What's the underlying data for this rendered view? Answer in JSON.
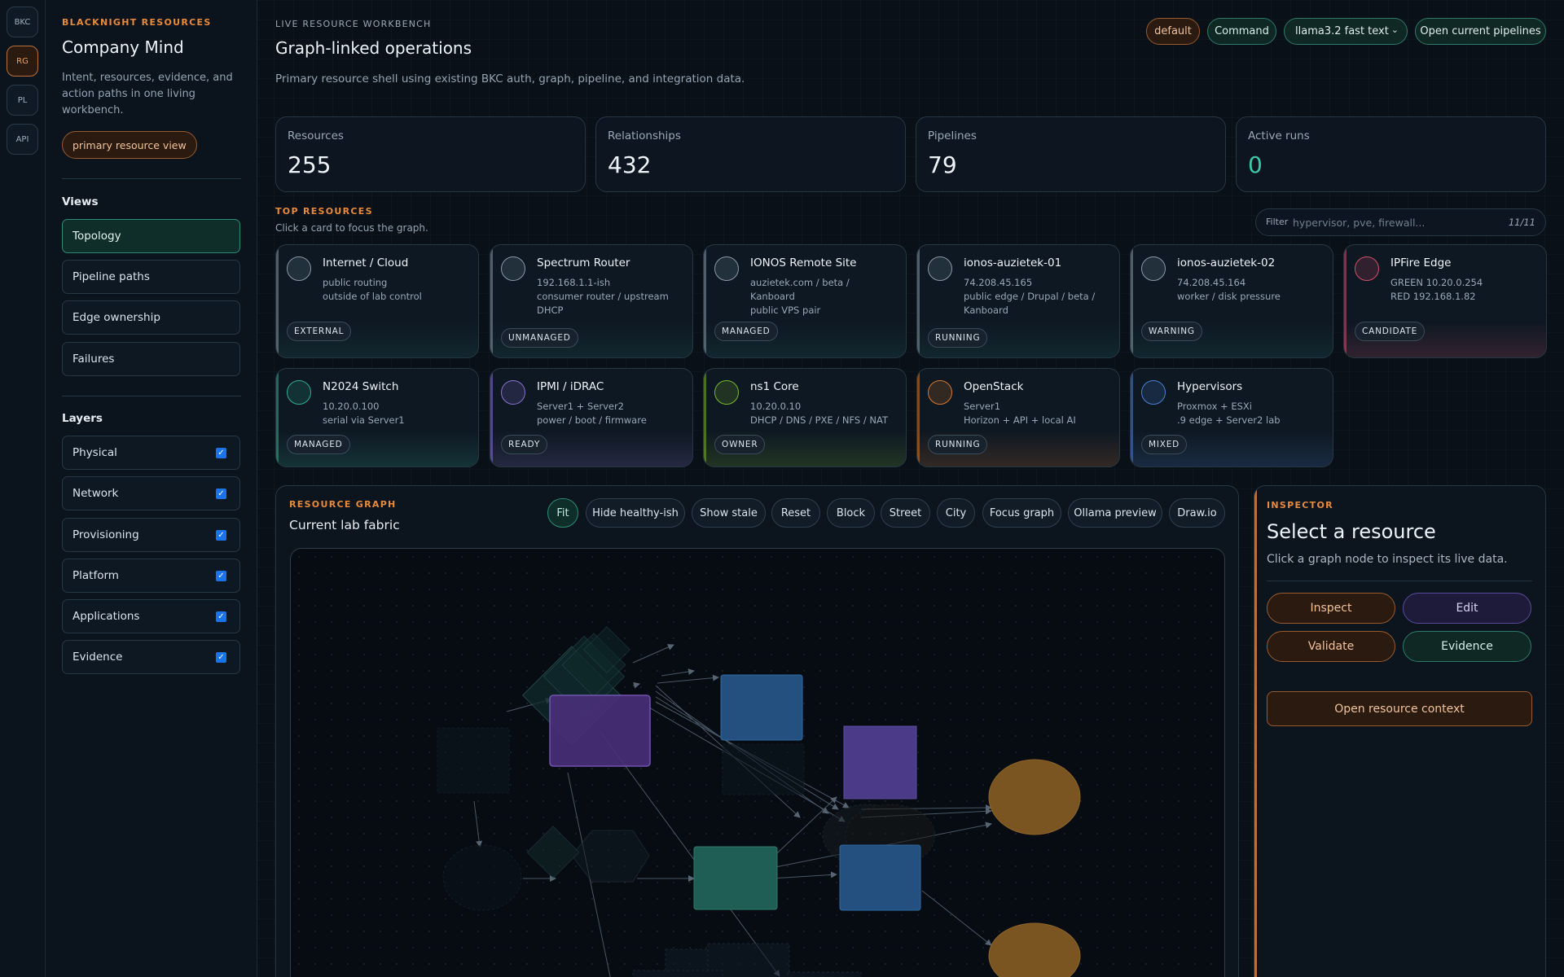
{
  "rail": {
    "items": [
      "BKC",
      "RG",
      "PL",
      "API"
    ],
    "active": "RG"
  },
  "sidebar": {
    "eyebrow": "BLACKNIGHT RESOURCES",
    "title": "Company Mind",
    "description": "Intent, resources, evidence, and action paths in one living workbench.",
    "primary_pill": "primary resource view",
    "views_heading": "Views",
    "views": [
      {
        "label": "Topology",
        "active": true
      },
      {
        "label": "Pipeline paths",
        "active": false
      },
      {
        "label": "Edge ownership",
        "active": false
      },
      {
        "label": "Failures",
        "active": false
      }
    ],
    "layers_heading": "Layers",
    "layers": [
      {
        "label": "Physical",
        "checked": true
      },
      {
        "label": "Network",
        "checked": true
      },
      {
        "label": "Provisioning",
        "checked": true
      },
      {
        "label": "Platform",
        "checked": true
      },
      {
        "label": "Applications",
        "checked": true
      },
      {
        "label": "Evidence",
        "checked": true
      }
    ]
  },
  "header": {
    "eyebrow": "LIVE RESOURCE WORKBENCH",
    "title": "Graph-linked operations",
    "description": "Primary resource shell using existing BKC auth, graph, pipeline, and integration data.",
    "default_label": "default",
    "command_label": "Command",
    "model_select": "llama3.2 fast text",
    "open_pipelines_label": "Open current pipelines"
  },
  "stats": [
    {
      "label": "Resources",
      "value": "255"
    },
    {
      "label": "Relationships",
      "value": "432"
    },
    {
      "label": "Pipelines",
      "value": "79"
    },
    {
      "label": "Active runs",
      "value": "0",
      "accent": "#3ec8a6"
    }
  ],
  "top_resources": {
    "eyebrow": "TOP RESOURCES",
    "subtitle": "Click a card to focus the graph.",
    "filter_label": "Filter",
    "filter_placeholder": "hypervisor, pve, firewall...",
    "filter_count": "11/11",
    "cards": [
      {
        "name": "Internet / Cloud",
        "meta": [
          "public routing",
          "outside of lab control"
        ],
        "badge": "EXTERNAL",
        "color": "#8a98a6"
      },
      {
        "name": "Spectrum Router",
        "meta": [
          "192.168.1.1-ish",
          "consumer router / upstream DHCP"
        ],
        "badge": "UNMANAGED",
        "color": "#8a98a6"
      },
      {
        "name": "IONOS Remote Site",
        "meta": [
          "auzietek.com / beta / Kanboard",
          "public VPS pair"
        ],
        "badge": "MANAGED",
        "color": "#8a98a6"
      },
      {
        "name": "ionos-auzietek-01",
        "meta": [
          "74.208.45.165",
          "public edge / Drupal / beta / Kanboard"
        ],
        "badge": "RUNNING",
        "color": "#8a98a6"
      },
      {
        "name": "ionos-auzietek-02",
        "meta": [
          "74.208.45.164",
          "worker / disk pressure"
        ],
        "badge": "WARNING",
        "color": "#8a98a6"
      },
      {
        "name": "IPFire Edge",
        "meta": [
          "GREEN 10.20.0.254",
          "RED 192.168.1.82"
        ],
        "badge": "CANDIDATE",
        "color": "#d0506a"
      },
      {
        "name": "N2024 Switch",
        "meta": [
          "10.20.0.100",
          "serial via Server1"
        ],
        "badge": "MANAGED",
        "color": "#2fae8e"
      },
      {
        "name": "IPMI / iDRAC",
        "meta": [
          "Server1 + Server2",
          "power / boot / firmware"
        ],
        "badge": "READY",
        "color": "#8a70d0"
      },
      {
        "name": "ns1 Core",
        "meta": [
          "10.20.0.10",
          "DHCP / DNS / PXE / NFS / NAT"
        ],
        "badge": "OWNER",
        "color": "#7ab82a"
      },
      {
        "name": "OpenStack",
        "meta": [
          "Server1",
          "Horizon + API + local AI"
        ],
        "badge": "RUNNING",
        "color": "#d8782e"
      },
      {
        "name": "Hypervisors",
        "meta": [
          "Proxmox + ESXi",
          ".9 edge + Server2 lab"
        ],
        "badge": "MIXED",
        "color": "#4a80d0"
      }
    ]
  },
  "graph": {
    "eyebrow": "RESOURCE GRAPH",
    "title": "Current lab fabric",
    "buttons": [
      "Fit",
      "Hide healthy-ish",
      "Show stale",
      "Reset",
      "Block",
      "Street",
      "City",
      "Focus graph",
      "Ollama preview",
      "Draw.io"
    ],
    "active_button": "Fit"
  },
  "inspector": {
    "eyebrow": "INSPECTOR",
    "title": "Select a resource",
    "subtitle": "Click a graph node to inspect its live data.",
    "inspect_label": "Inspect",
    "edit_label": "Edit",
    "validate_label": "Validate",
    "evidence_label": "Evidence",
    "context_label": "Open resource context"
  },
  "colors": {
    "accent_orange": "#e88a3a",
    "accent_teal": "#2fae8e",
    "background": "#0a1018"
  }
}
